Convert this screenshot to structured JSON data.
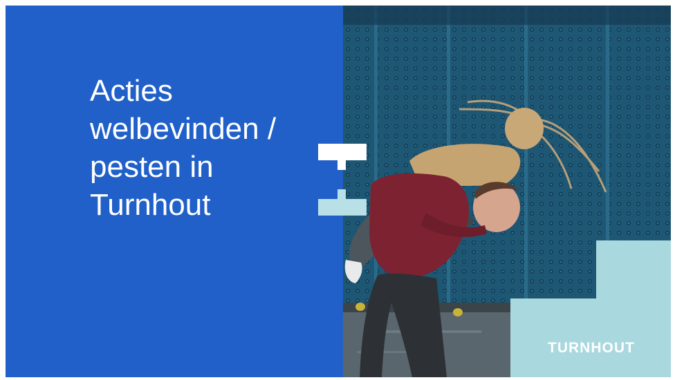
{
  "slide": {
    "title": "Acties welbevinden / pesten in Turnhout",
    "brand_wordmark": "TURNHOUT"
  },
  "colors": {
    "primary_blue": "#2060c8",
    "logo_white": "#ffffff",
    "logo_lightblue": "#b9e0e6",
    "brand_block": "#a9d8de",
    "wall_teal": "#1f5b78"
  },
  "icons": {
    "logo_mark": "turnhout-t-logo-icon"
  }
}
